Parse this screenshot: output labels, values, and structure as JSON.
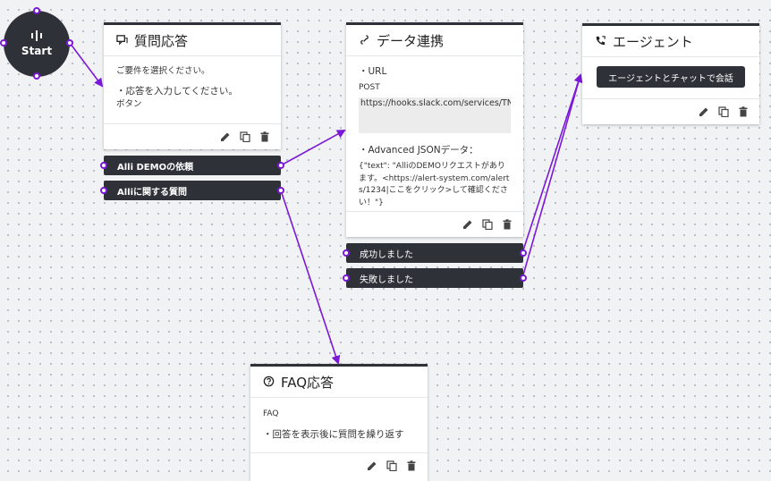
{
  "start": {
    "label": "Start"
  },
  "qa_card": {
    "title": "質問応答",
    "prompt": "ご要件を選択ください。",
    "bullet": "・応答を入力してください。",
    "button_text": "ボタン"
  },
  "qa_branches": [
    "Alli DEMOの依頼",
    "Alliに関する質問"
  ],
  "data_card": {
    "title": "データ連携",
    "url_heading": "・URL",
    "method": "POST",
    "url": "https://hooks.slack.com/services/TN",
    "json_heading": "・Advanced JSONデータ：",
    "json_body": "{\"text\": \"AlliのDEMOリクエストがあります。<https://alert-system.com/alerts/1234|ここをクリック>して確認ください！\"}"
  },
  "data_branches": [
    "成功しました",
    "失敗しました"
  ],
  "agent_card": {
    "title": "エージェント",
    "button": "エージェントとチャットで会話"
  },
  "faq_card": {
    "title": "FAQ応答",
    "label": "FAQ",
    "bullet": "・回答を表示後に質問を繰り返す"
  },
  "colors": {
    "connector": "#7b18d8",
    "node_dark": "#2e3138"
  }
}
